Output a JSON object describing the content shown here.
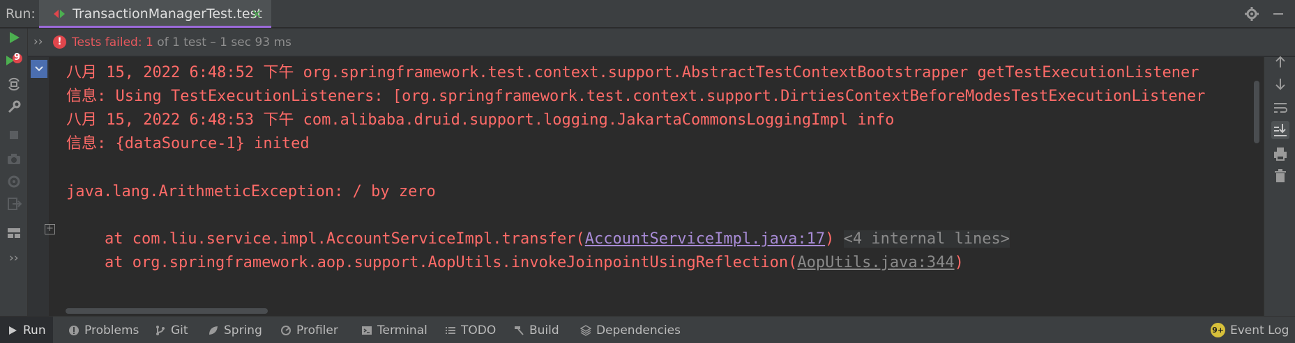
{
  "header": {
    "run_label": "Run:",
    "tab_label": "TransactionManagerTest.test",
    "tab_close": "×"
  },
  "status": {
    "failed_text": "Tests failed: 1",
    "rest_text": " of 1 test – 1 sec 93 ms",
    "error_glyph": "!",
    "chevron": "››"
  },
  "left_toolbar": {
    "failed_count_badge": "9",
    "more": "››"
  },
  "console": {
    "lines": [
      "八月 15, 2022 6:48:52 下午 org.springframework.test.context.support.AbstractTestContextBootstrapper getTestExecutionListener",
      "信息: Using TestExecutionListeners: [org.springframework.test.context.support.DirtiesContextBeforeModesTestExecutionListener",
      "八月 15, 2022 6:48:53 下午 com.alibaba.druid.support.logging.JakartaCommonsLoggingImpl info",
      "信息: {dataSource-1} inited",
      "java.lang.ArithmeticException: / by zero"
    ],
    "stack": [
      {
        "prefix": "at com.liu.service.impl.AccountServiceImpl.transfer(",
        "link": "AccountServiceImpl.java:17",
        "suffix": ")",
        "internal": "<4 internal lines>"
      },
      {
        "prefix": "at org.springframework.aop.support.AopUtils.invokeJoinpointUsingReflection(",
        "link": "AopUtils.java:344",
        "suffix": ")"
      }
    ],
    "expand_glyph": "+"
  },
  "bottom_bar": {
    "items": [
      {
        "label": "Run",
        "icon": "play-icon"
      },
      {
        "label": "Problems",
        "icon": "problems-icon"
      },
      {
        "label": "Git",
        "icon": "git-branch-icon"
      },
      {
        "label": "Spring",
        "icon": "spring-leaf-icon"
      },
      {
        "label": "Profiler",
        "icon": "profiler-icon"
      },
      {
        "label": "Terminal",
        "icon": "terminal-icon"
      },
      {
        "label": "TODO",
        "icon": "todo-list-icon"
      },
      {
        "label": "Build",
        "icon": "hammer-icon"
      },
      {
        "label": "Dependencies",
        "icon": "dependencies-icon"
      }
    ],
    "event_log": "Event Log",
    "event_badge": "9+"
  },
  "colors": {
    "accent_purple": "#9b6ad8",
    "error_red": "#ff6b68",
    "run_green": "#4caf50"
  }
}
